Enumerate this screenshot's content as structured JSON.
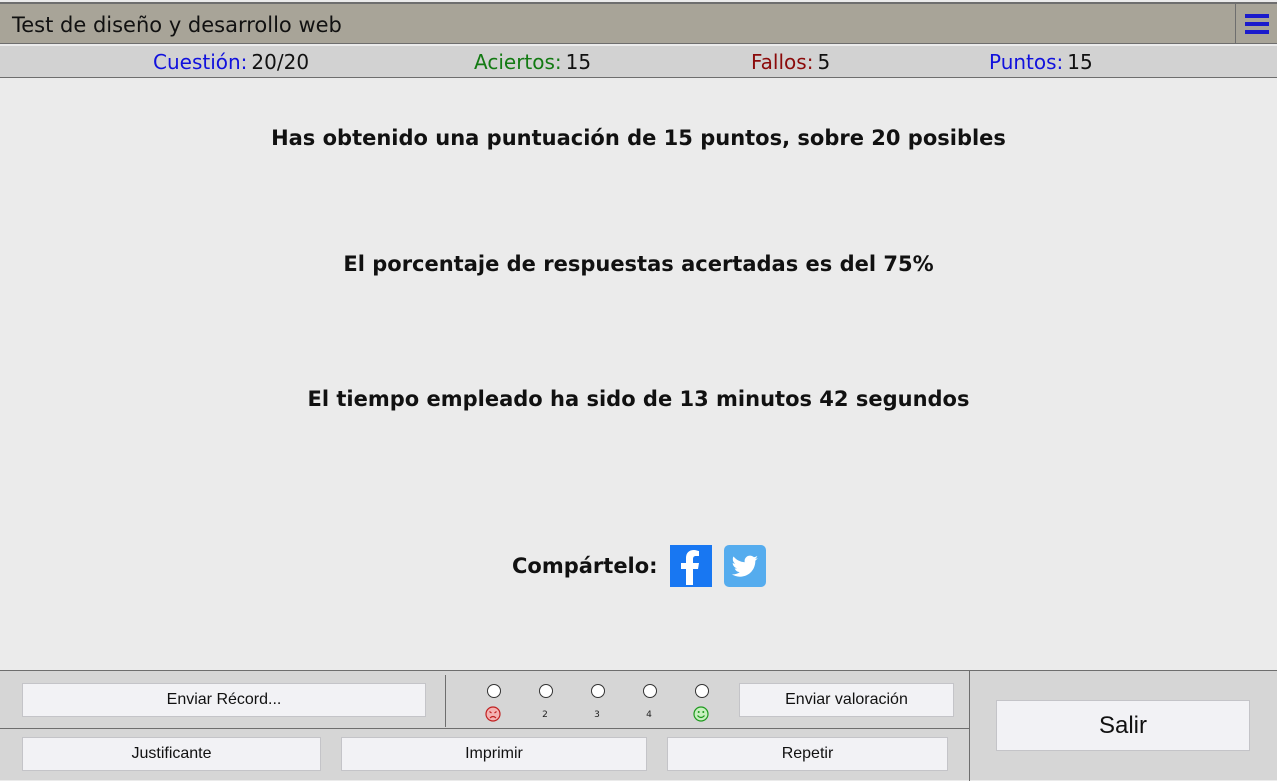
{
  "app": {
    "title": "Test de diseño y desarrollo web"
  },
  "status": {
    "question_label": "Cuestión:",
    "question_value": "20/20",
    "hits_label": "Aciertos:",
    "hits_value": "15",
    "fails_label": "Fallos:",
    "fails_value": "5",
    "points_label": "Puntos:",
    "points_value": "15"
  },
  "results": {
    "score": "Has obtenido una puntuación de 15 puntos, sobre 20 posibles",
    "percent": "El porcentaje de respuestas acertadas es del 75%",
    "time": "El tiempo empleado ha sido de 13 minutos 42 segundos"
  },
  "share": {
    "label": "Compártelo:",
    "icons": [
      "facebook-icon",
      "twitter-icon"
    ]
  },
  "footer": {
    "send_record": "Enviar Récord...",
    "send_rating": "Enviar valoración",
    "certificate": "Justificante",
    "print": "Imprimir",
    "repeat": "Repetir",
    "exit": "Salir",
    "rating_labels": [
      "",
      "2",
      "3",
      "4",
      ""
    ]
  },
  "colors": {
    "titlebar": "#a8a498",
    "accent_blue": "#1111dd",
    "hits_green": "#137a13",
    "fails_red": "#8b0a0a",
    "facebook": "#1877f2",
    "twitter": "#55acee"
  }
}
